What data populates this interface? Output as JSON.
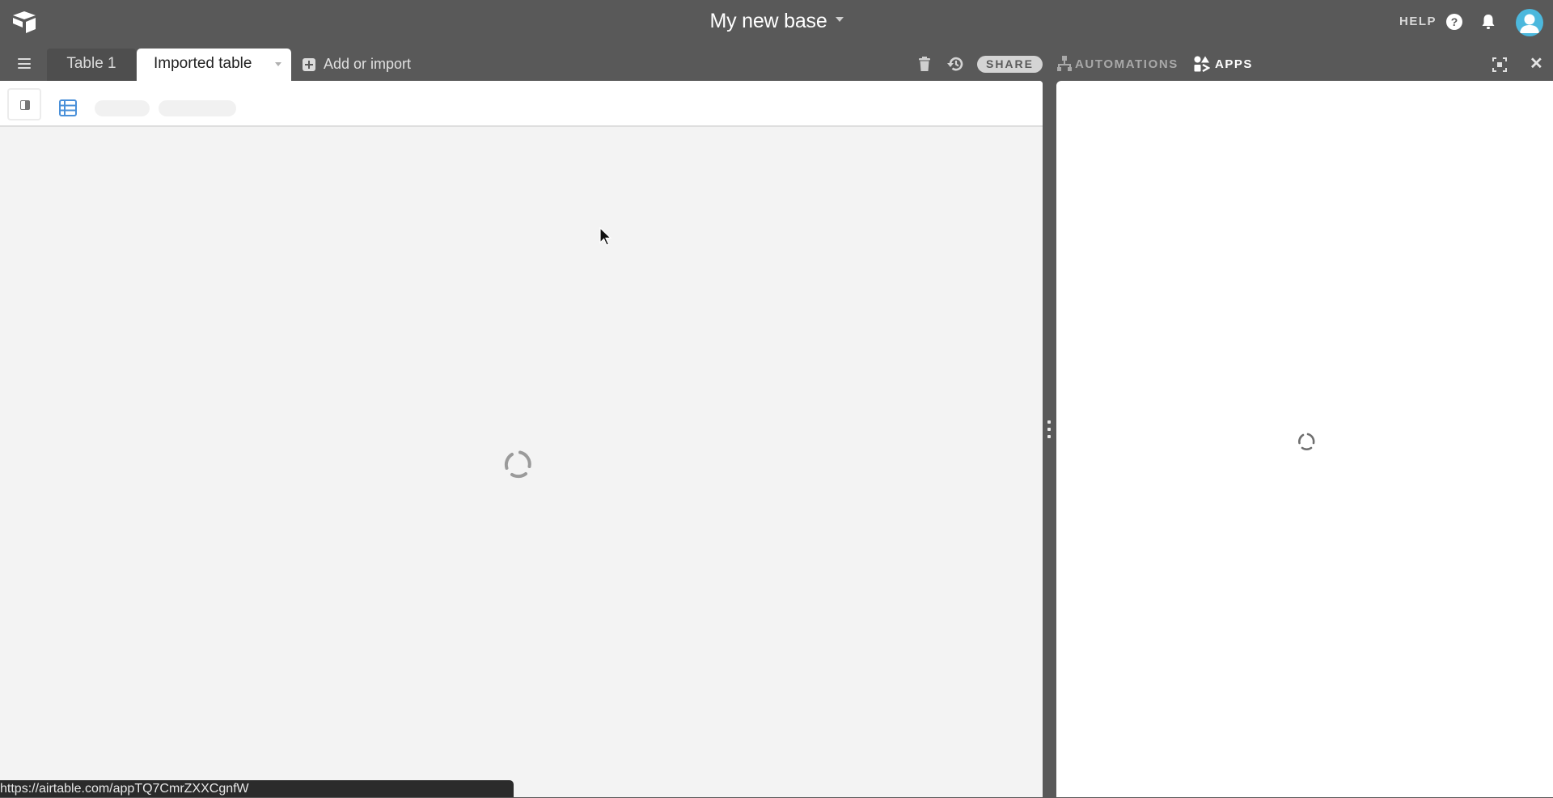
{
  "app": {
    "base_title": "My new base",
    "help_label": "HELP",
    "help_icon_glyph": "?",
    "avatar_color": "#4cb8dd"
  },
  "tabs": [
    {
      "label": "Table 1",
      "active": false
    },
    {
      "label": "Imported table",
      "active": true
    }
  ],
  "tabbar": {
    "add_or_import_label": "Add or import",
    "share_label": "SHARE",
    "automations_label": "AUTOMATIONS",
    "apps_label": "APPS",
    "close_glyph": "✕"
  },
  "main": {
    "state": "loading"
  },
  "right_panel": {
    "state": "loading"
  },
  "status_bar": {
    "url": "https://airtable.com/appTQ7CmrZXXCgnfW"
  },
  "colors": {
    "chrome": "#595959",
    "main_bg": "#f3f3f3",
    "grid_icon": "#4a90d9"
  }
}
